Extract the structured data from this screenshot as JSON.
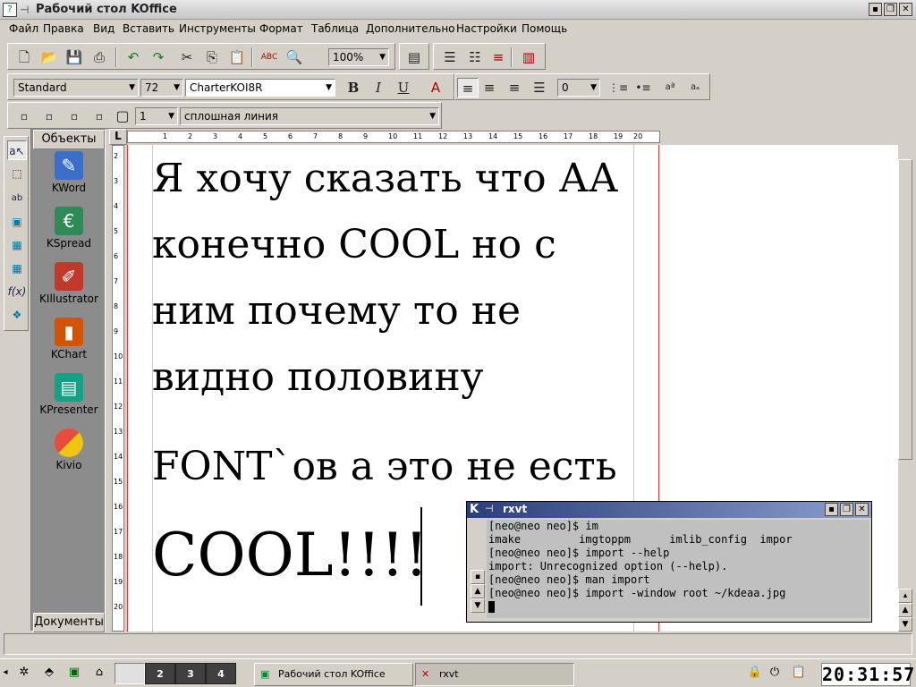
{
  "window": {
    "title": "Рабочий стол KOffice"
  },
  "menu": [
    "Файл",
    "Правка",
    "Вид",
    "Вставить",
    "Инструменты",
    "Формат",
    "Таблица",
    "Дополнительно",
    "Настройки",
    "Помощь"
  ],
  "toolbar1": {
    "zoom": "100%"
  },
  "toolbar2": {
    "style": "Standard",
    "size": "72",
    "font": "CharterKOI8R",
    "spacing": "0",
    "bold": "B",
    "italic": "I",
    "underline": "U"
  },
  "toolbar3": {
    "line_width": "1",
    "line_style": "сплошная линия"
  },
  "objects_panel": {
    "tab_objects": "Объекты",
    "tab_documents": "Документы",
    "apps": [
      "KWord",
      "KSpread",
      "KIllustrator",
      "KChart",
      "KPresenter",
      "Kivio"
    ]
  },
  "ruler": {
    "horizontal": [
      "1",
      "2",
      "3",
      "4",
      "5",
      "6",
      "7",
      "8",
      "9",
      "10",
      "11",
      "12",
      "13",
      "14",
      "15",
      "16",
      "17",
      "18",
      "19",
      "20"
    ],
    "vertical": [
      "2",
      "3",
      "4",
      "5",
      "6",
      "7",
      "8",
      "9",
      "10",
      "11",
      "12",
      "13",
      "14",
      "15",
      "16",
      "17",
      "18",
      "19",
      "20"
    ]
  },
  "document": {
    "lines": [
      "Я хочу сказать что АА",
      "конечно COOL но с",
      "ним почему то не",
      "видно половину",
      "FONT`ов а это не есть",
      "COOL!!!!"
    ]
  },
  "terminal": {
    "title": "rxvt",
    "lines": [
      "[neo@neo neo]$ im",
      "imake         imgtoppm      imlib_config  impor",
      "[neo@neo neo]$ import --help",
      "import: Unrecognized option (--help).",
      "[neo@neo neo]$ man import",
      "[neo@neo neo]$ import -window root ~/kdeaa.jpg"
    ]
  },
  "taskbar": {
    "desktops": [
      "2",
      "3",
      "4"
    ],
    "tasks": [
      "Рабочий стол KOffice",
      "rxvt"
    ],
    "clock": "20:31:57"
  }
}
